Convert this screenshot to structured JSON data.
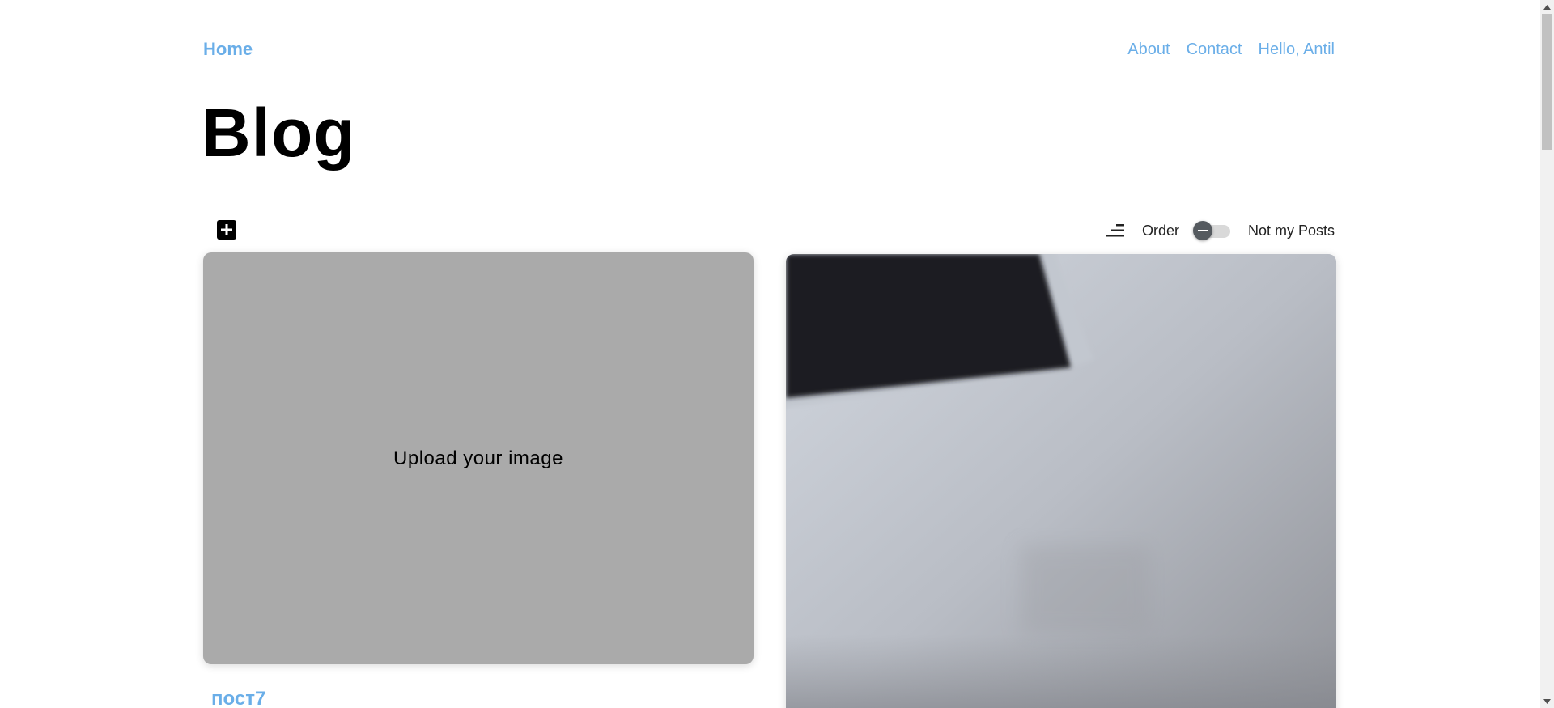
{
  "nav": {
    "home_label": "Home",
    "links": [
      {
        "label": "About"
      },
      {
        "label": "Contact"
      },
      {
        "label": "Hello, Antil"
      }
    ]
  },
  "page": {
    "title": "Blog"
  },
  "toolbar": {
    "add_icon": "plus-square-icon",
    "sort_icon": "sort-icon",
    "order_label": "Order",
    "toggle_on": false,
    "filter_label": "Not my Posts"
  },
  "posts": [
    {
      "upload_text": "Upload your image",
      "title": "пост7"
    },
    {
      "image": "photo-image"
    }
  ],
  "colors": {
    "accent": "#6aaee8",
    "placeholder_bg": "#aaaaaa"
  }
}
